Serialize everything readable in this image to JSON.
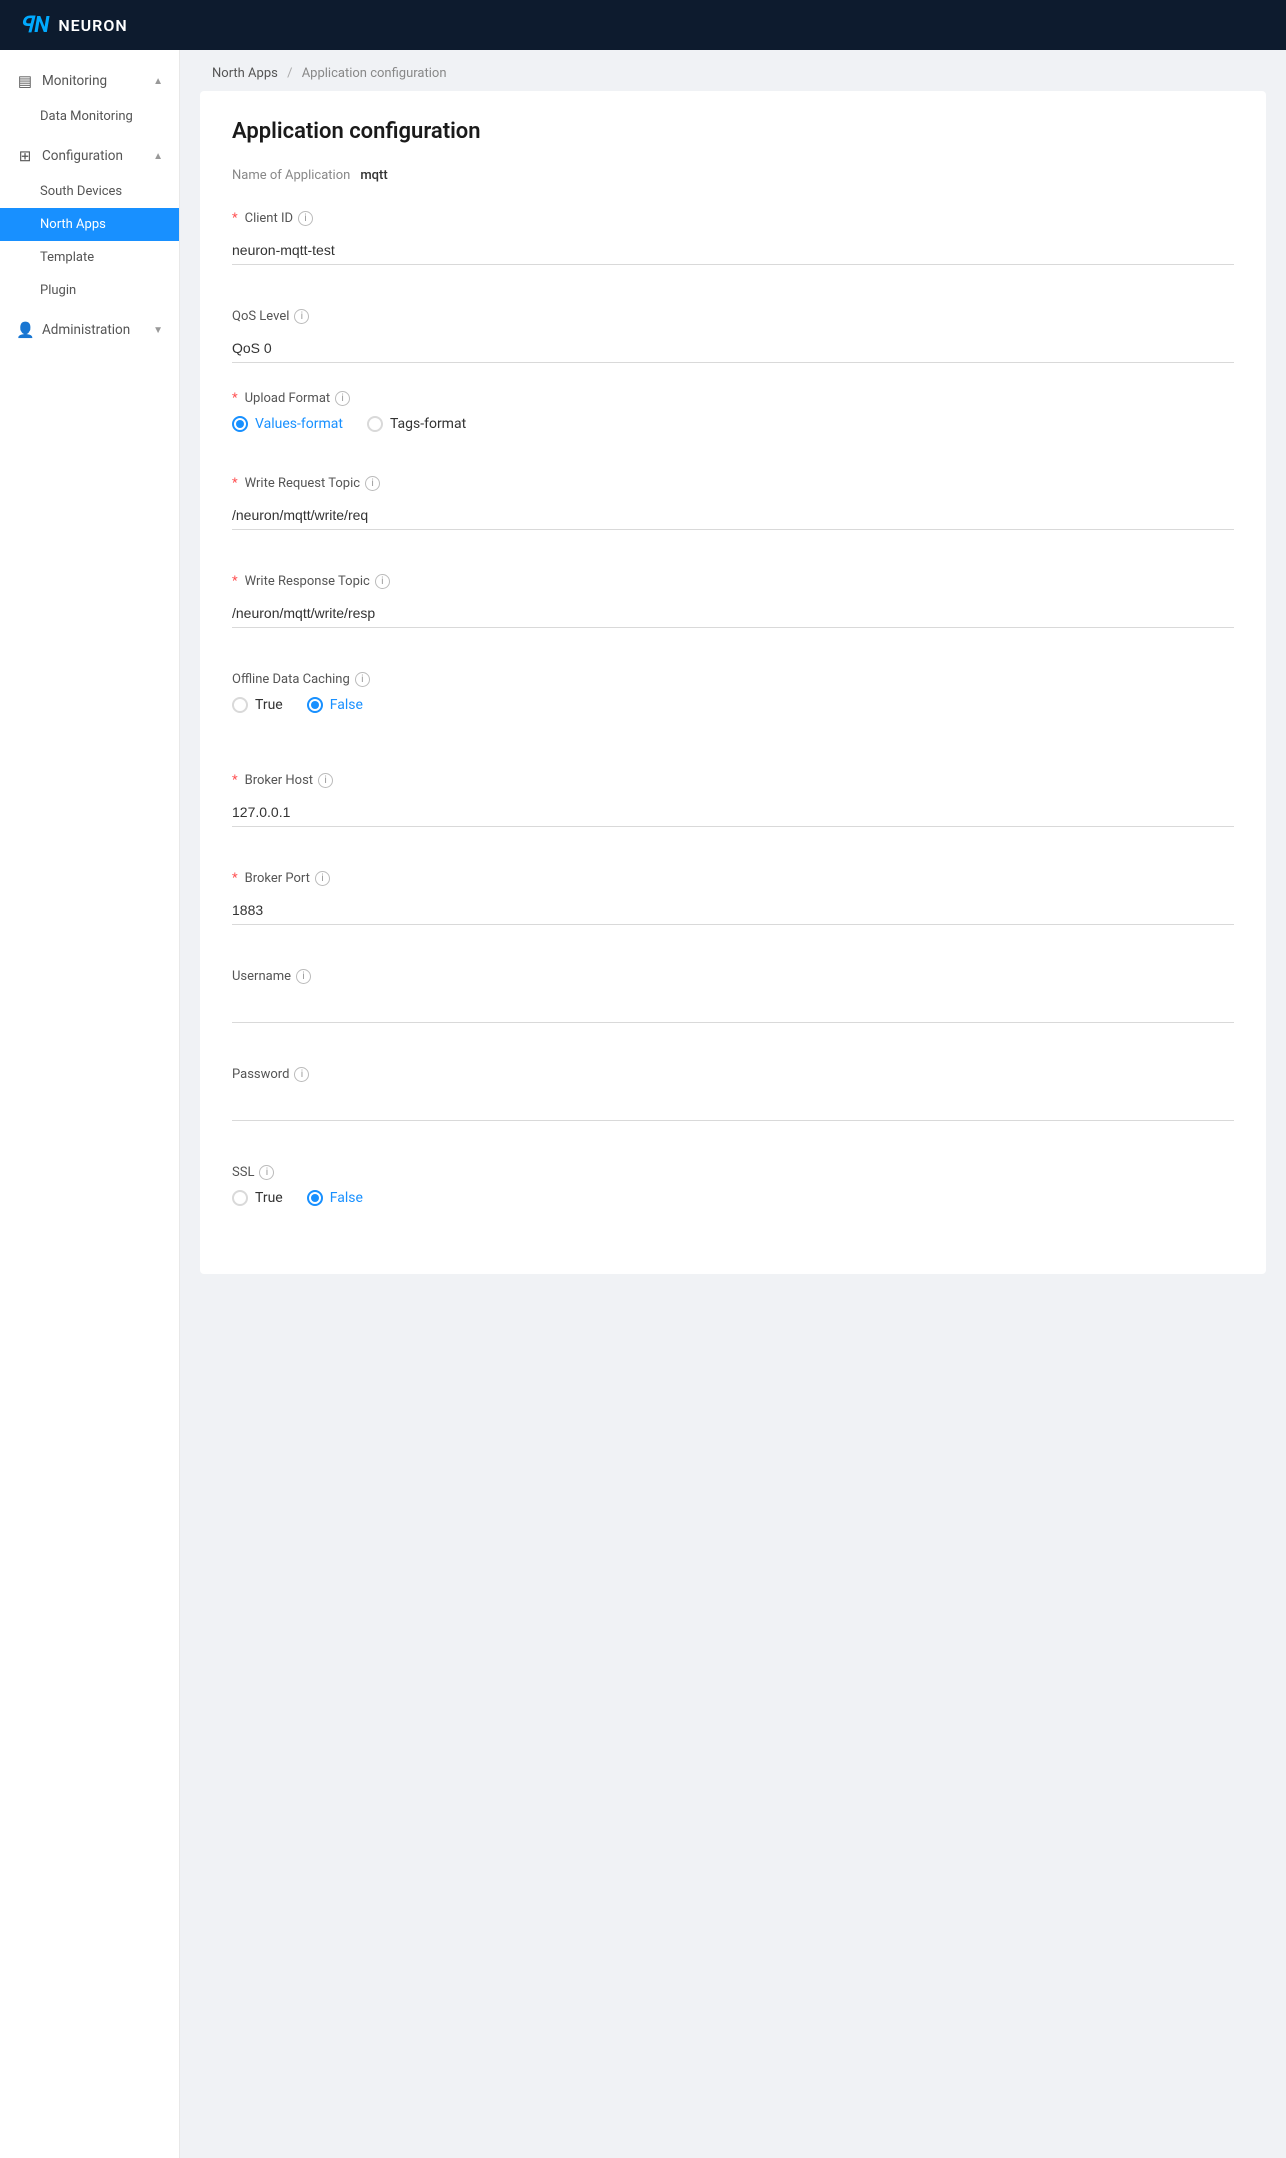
{
  "topnav": {
    "logo_icon": "ꟼN",
    "logo_text": "NEURON"
  },
  "sidebar": {
    "monitoring_label": "Monitoring",
    "monitoring_sub": [
      "Data Monitoring"
    ],
    "configuration_label": "Configuration",
    "south_devices_label": "South Devices",
    "north_apps_label": "North Apps",
    "template_label": "Template",
    "plugin_label": "Plugin",
    "administration_label": "Administration"
  },
  "breadcrumb": {
    "parent": "North Apps",
    "separator": "/",
    "current": "Application configuration"
  },
  "form": {
    "page_title": "Application configuration",
    "app_name_label": "Name of Application",
    "app_name_value": "mqtt",
    "client_id_label": "Client ID",
    "client_id_info": "i",
    "client_id_value": "neuron-mqtt-test",
    "qos_level_label": "QoS Level",
    "qos_level_info": "i",
    "qos_level_value": "QoS 0",
    "upload_format_label": "Upload Format",
    "upload_format_info": "i",
    "upload_format_options": [
      {
        "label": "Values-format",
        "selected": true
      },
      {
        "label": "Tags-format",
        "selected": false
      }
    ],
    "write_request_topic_label": "Write Request Topic",
    "write_request_topic_info": "i",
    "write_request_topic_value": "/neuron/mqtt/write/req",
    "write_response_topic_label": "Write Response Topic",
    "write_response_topic_info": "i",
    "write_response_topic_value": "/neuron/mqtt/write/resp",
    "offline_data_caching_label": "Offline Data Caching",
    "offline_data_caching_info": "i",
    "offline_data_caching_options": [
      {
        "label": "True",
        "selected": false
      },
      {
        "label": "False",
        "selected": true
      }
    ],
    "broker_host_label": "Broker Host",
    "broker_host_info": "i",
    "broker_host_value": "127.0.0.1",
    "broker_port_label": "Broker Port",
    "broker_port_info": "i",
    "broker_port_value": "1883",
    "username_label": "Username",
    "username_info": "i",
    "username_value": "",
    "password_label": "Password",
    "password_info": "i",
    "password_value": "",
    "ssl_label": "SSL",
    "ssl_info": "i",
    "ssl_options": [
      {
        "label": "True",
        "selected": false
      },
      {
        "label": "False",
        "selected": true
      }
    ]
  }
}
